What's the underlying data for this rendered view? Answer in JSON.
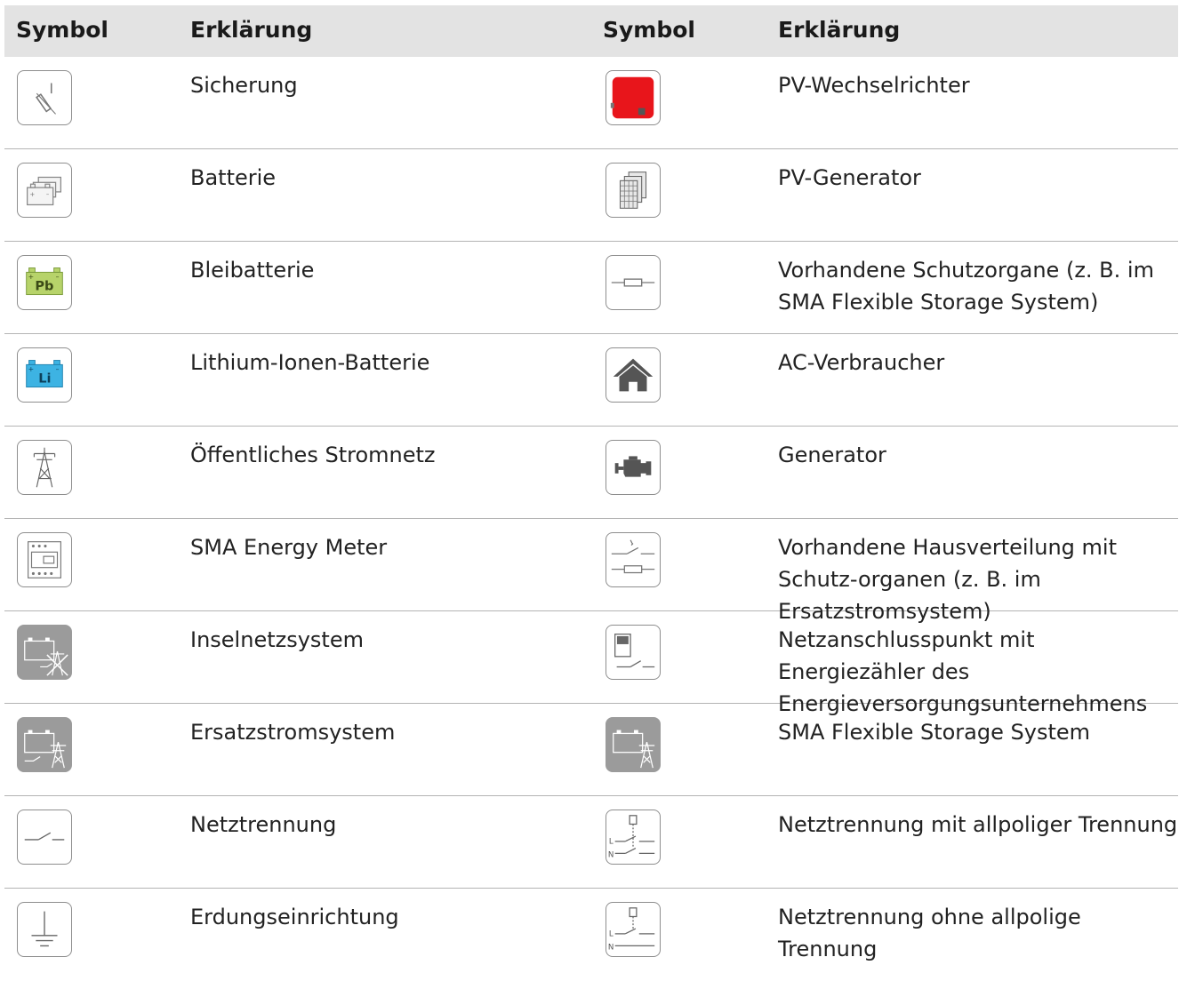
{
  "headers": {
    "symbol_left": "Symbol",
    "explanation_left": "Erklärung",
    "symbol_right": "Symbol",
    "explanation_right": "Erklärung"
  },
  "rows": [
    {
      "left": {
        "icon": "fuse-icon",
        "text": "Sicherung"
      },
      "right": {
        "icon": "pv-inverter-icon",
        "text": "PV-Wechselrichter"
      }
    },
    {
      "left": {
        "icon": "battery-icon",
        "text": "Batterie"
      },
      "right": {
        "icon": "pv-generator-icon",
        "text": "PV-Generator"
      }
    },
    {
      "left": {
        "icon": "lead-battery-icon",
        "text": "Bleibatterie"
      },
      "right": {
        "icon": "protective-device-icon",
        "text": "Vorhandene Schutzorgane (z. B. im SMA Flexible Storage System)"
      }
    },
    {
      "left": {
        "icon": "lithium-battery-icon",
        "text": "Lithium-Ionen-Batterie"
      },
      "right": {
        "icon": "house-icon",
        "text": "AC-Verbraucher"
      }
    },
    {
      "left": {
        "icon": "power-pylon-icon",
        "text": "Öffentliches Stromnetz"
      },
      "right": {
        "icon": "engine-generator-icon",
        "text": "Generator"
      }
    },
    {
      "left": {
        "icon": "energy-meter-icon",
        "text": "SMA Energy Meter"
      },
      "right": {
        "icon": "distribution-board-icon",
        "text": "Vorhandene Hausverteilung mit Schutz-organen (z. B. im Ersatzstromsystem)"
      }
    },
    {
      "left": {
        "icon": "off-grid-system-icon",
        "text": "Inselnetzsystem"
      },
      "right": {
        "icon": "grid-connection-meter-icon",
        "text": "Netzanschlusspunkt mit Energiezähler des Energieversorgungsunternehmens"
      }
    },
    {
      "left": {
        "icon": "backup-system-icon",
        "text": "Ersatzstromsystem"
      },
      "right": {
        "icon": "flexible-storage-icon",
        "text": "SMA Flexible Storage System"
      }
    },
    {
      "left": {
        "icon": "disconnect-switch-icon",
        "text": "Netztrennung"
      },
      "right": {
        "icon": "all-pole-disconnect-icon",
        "text": "Netztrennung mit allpoliger Trennung"
      }
    },
    {
      "left": {
        "icon": "grounding-icon",
        "text": "Erdungseinrichtung"
      },
      "right": {
        "icon": "non-all-pole-disconnect-icon",
        "text": "Netztrennung ohne allpolige Trennung"
      }
    }
  ],
  "colors": {
    "header_bg": "#e3e3e3",
    "divider": "#b4b4b4",
    "icon_border": "#8e8e8e",
    "dark_icon_bg": "#9b9b9b",
    "inverter_red": "#e8151b",
    "lead_green": "#b7d36a",
    "lithium_blue": "#3db3e3"
  }
}
